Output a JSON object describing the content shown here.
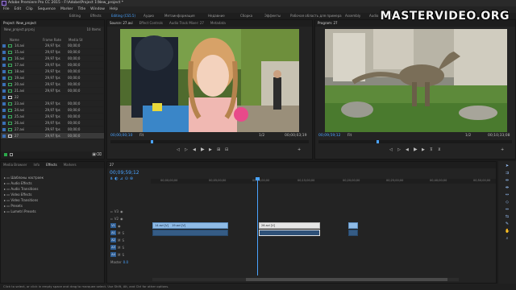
{
  "window": {
    "title": "Adobe Premiere Pro CC 2015 - F:\\Adobe\\Project 1\\New_project *"
  },
  "menu": [
    "File",
    "Edit",
    "Clip",
    "Sequence",
    "Marker",
    "Title",
    "Window",
    "Help"
  ],
  "workspaces": [
    {
      "label": "Editing",
      "active": false
    },
    {
      "label": "Effects",
      "active": false
    },
    {
      "label": "Editing (CS5.5)",
      "active": true
    },
    {
      "label": "Аудио",
      "active": false
    },
    {
      "label": "Метаинформация",
      "active": false
    },
    {
      "label": "Недавние",
      "active": false
    },
    {
      "label": "Сборка",
      "active": false
    },
    {
      "label": "Эффекты",
      "active": false
    },
    {
      "label": "Рабочая область для примера",
      "active": false
    },
    {
      "label": "Assembly",
      "active": false
    },
    {
      "label": "Audio",
      "active": false
    },
    {
      "label": "Color",
      "active": false
    }
  ],
  "watermark": "MASTERVIDEO.ORG",
  "project": {
    "tab": "Project: New_project",
    "path": "New_project.prproj",
    "count": "10 Items",
    "headers": {
      "name": "Name",
      "frame_rate": "Frame Rate",
      "media_start": "Media St"
    },
    "items": [
      {
        "name": "14.avi",
        "rate": "29,97 fps",
        "start": "00;00;0"
      },
      {
        "name": "15.avi",
        "rate": "29,97 fps",
        "start": "00;00;0"
      },
      {
        "name": "16.avi",
        "rate": "29,97 fps",
        "start": "00;00;0"
      },
      {
        "name": "17.avi",
        "rate": "29,97 fps",
        "start": "00;00;0"
      },
      {
        "name": "18.avi",
        "rate": "29,97 fps",
        "start": "00;00;0"
      },
      {
        "name": "19.avi",
        "rate": "29,97 fps",
        "start": "00;00;0"
      },
      {
        "name": "20.avi",
        "rate": "29,97 fps",
        "start": "00;00;0"
      },
      {
        "name": "21.avi",
        "rate": "29,97 fps",
        "start": "00;00;0"
      },
      {
        "name": "22",
        "rate": "",
        "start": ""
      },
      {
        "name": "23.avi",
        "rate": "29,97 fps",
        "start": "00;00;0"
      },
      {
        "name": "24.avi",
        "rate": "29,97 fps",
        "start": "00;00;0"
      },
      {
        "name": "25.avi",
        "rate": "29,97 fps",
        "start": "00;00;0"
      },
      {
        "name": "26.avi",
        "rate": "29,97 fps",
        "start": "00;00;0"
      },
      {
        "name": "27.avi",
        "rate": "29,97 fps",
        "start": "00;00;0"
      },
      {
        "name": "27",
        "rate": "29,97 fps",
        "start": "00;00;0"
      }
    ]
  },
  "source": {
    "tabs": [
      "Source: 27.avi",
      "Effect Controls",
      "Audio Track Mixer: 27",
      "Metadata"
    ],
    "timecode_left": "00;00;00;10",
    "fit": "Fit",
    "timecode_right": "00;00;03;19",
    "scale": "1/2"
  },
  "program": {
    "tab": "Program: 27",
    "timecode_left": "00;09;59;12",
    "fit": "Fit",
    "scale": "1/2",
    "timecode_right": "00;10;33;08"
  },
  "effects": {
    "tabs": [
      "Media Browser",
      "Info",
      "Effects",
      "Markers"
    ],
    "items": [
      "Шаблоны настроек",
      "Audio Effects",
      "Audio Transitions",
      "Video Effects",
      "Video Transitions",
      "Presets",
      "Lumetri Presets"
    ]
  },
  "timeline": {
    "tab": "27",
    "timecode": "00;09;59;12",
    "ruler": [
      "00;00;00;00",
      "00;05;00;00",
      "00;10;00;00",
      "00;15;00;00",
      "00;20;00;00",
      "00;25;00;00"
    ],
    "ruler_tail": [
      "00;30;00;00",
      "00;35;00;00",
      "00;40;00;00",
      "00;45;00;00",
      "00;50;00;00"
    ],
    "tracks": [
      "V3",
      "V2",
      "V1",
      "A1",
      "A2",
      "A3",
      "A4"
    ],
    "master": "Master",
    "master_value": "0.0",
    "clips": {
      "v1a": "14.avi [V]",
      "v1b": "19.avi [V]",
      "v1c": "26.avi [V]",
      "a1a": "",
      "a1c": ""
    }
  },
  "status_bar": "Click to select, or click in empty space and drag to marquee select. Use Shift, Alt, and Ctrl for other options.",
  "colors": {
    "accent": "#4aa3ff",
    "video_clip": "#8fbbe6",
    "audio_clip": "#355c86",
    "playhead": "#4aa3ff"
  }
}
